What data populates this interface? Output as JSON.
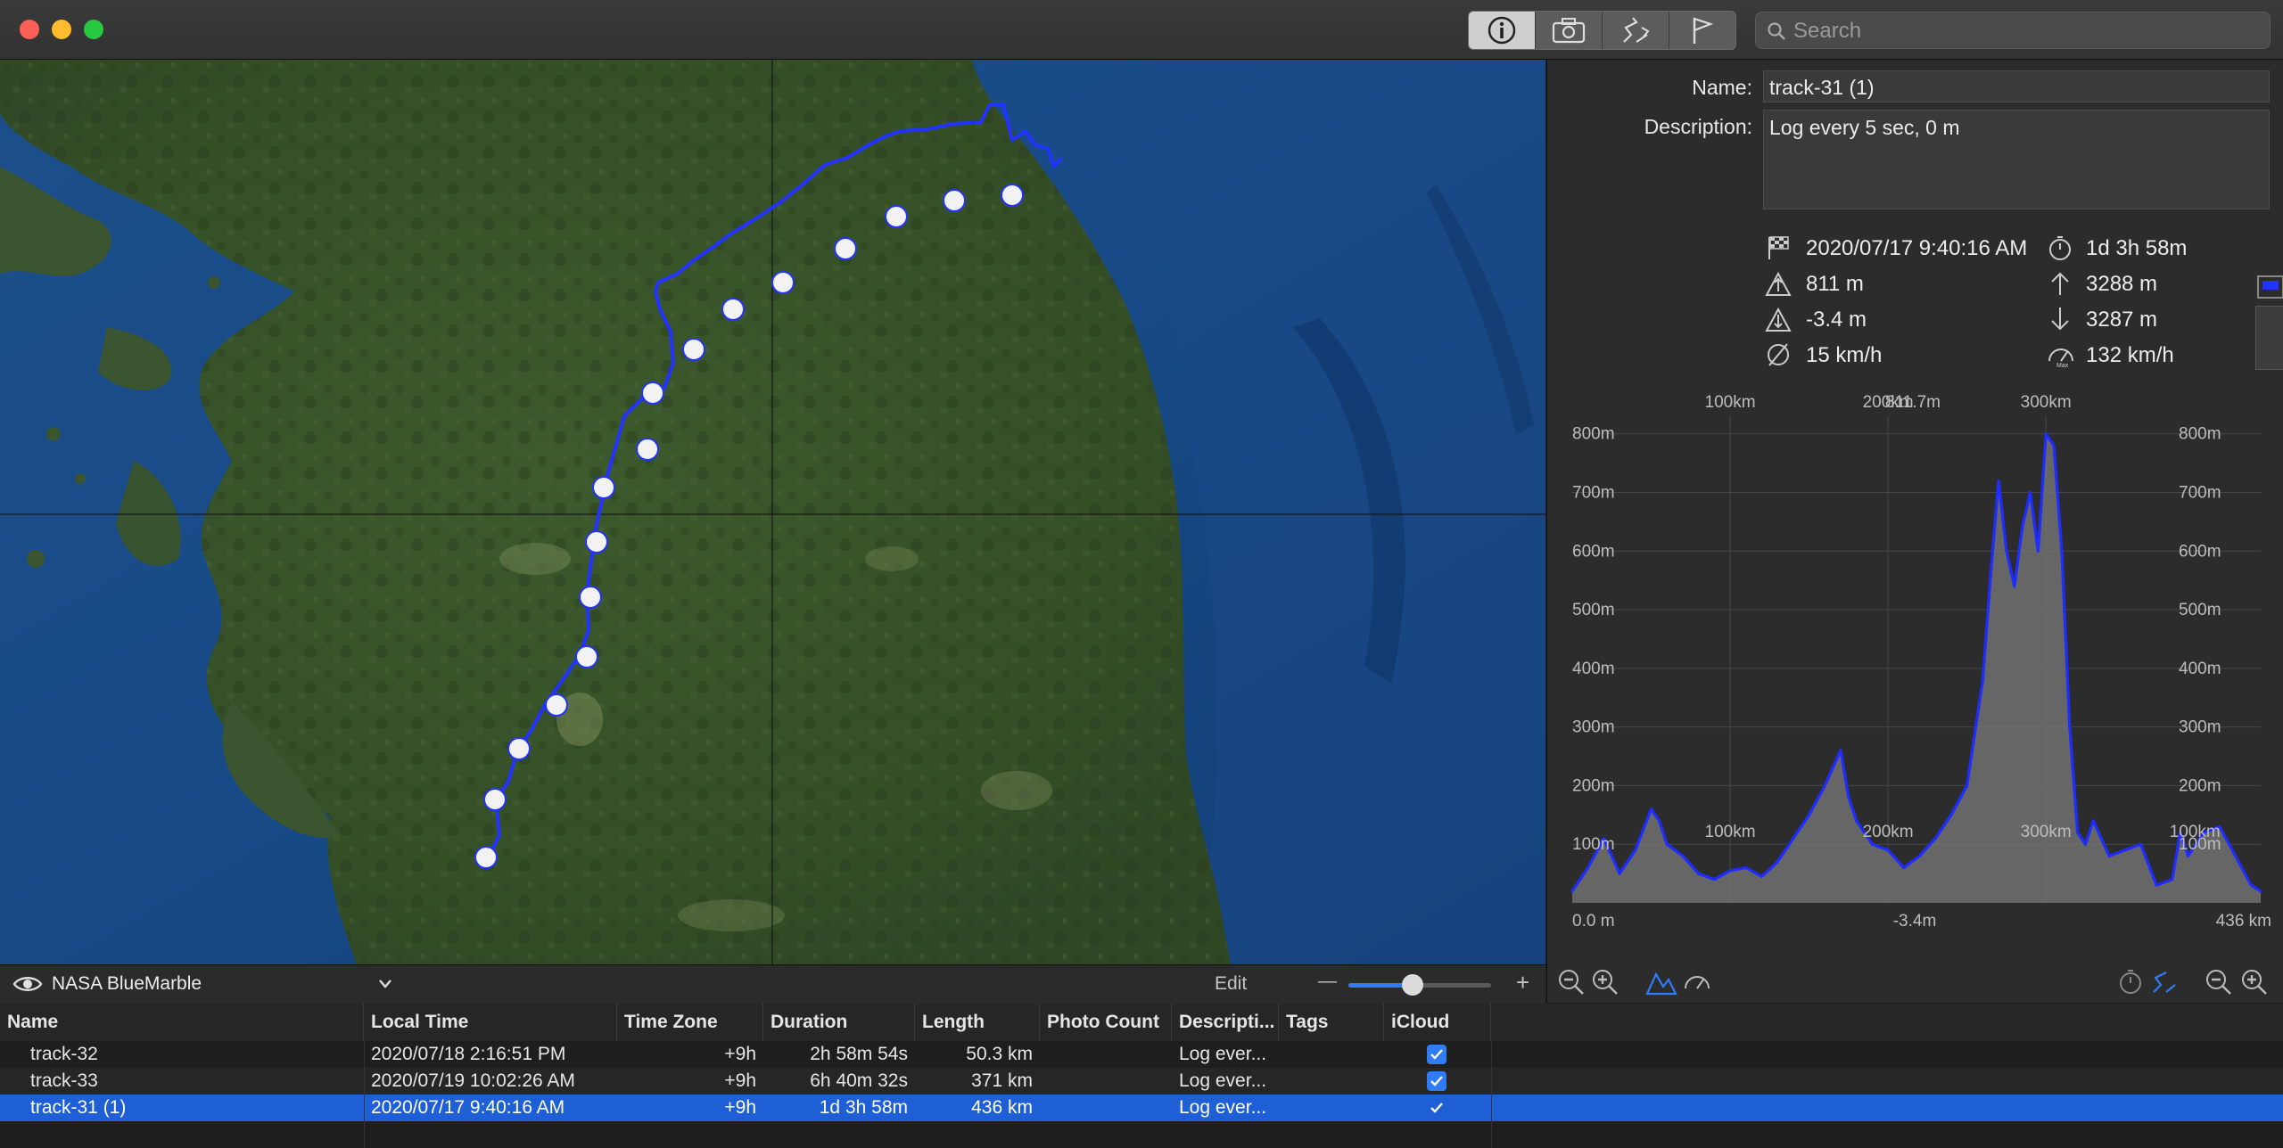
{
  "toolbar": {
    "tabs": [
      {
        "name": "info-icon",
        "active": true
      },
      {
        "name": "camera-icon",
        "active": false
      },
      {
        "name": "track-icon",
        "active": false
      },
      {
        "name": "flag-icon",
        "active": false
      }
    ],
    "search_placeholder": "Search"
  },
  "map": {
    "layer_name": "NASA BlueMarble",
    "edit_label": "Edit",
    "zoom_minus": "—",
    "zoom_plus": "+",
    "zoom_level": 0.45
  },
  "details": {
    "name_label": "Name:",
    "name_value": "track-31 (1)",
    "description_label": "Description:",
    "description_value": "Log every 5 sec, 0 m",
    "start_time": "2020/07/17 9:40:16 AM",
    "duration": "1d 3h 58m",
    "max_elevation": "811 m",
    "ascent": "3288 m",
    "min_elevation": "-3.4 m",
    "descent": "3287 m",
    "avg_speed": "15 km/h",
    "max_speed": "132 km/h"
  },
  "chart_data": {
    "type": "area",
    "peak_label": "811.7m",
    "min_label": "-3.4m",
    "y_ticks": [
      "100m",
      "200m",
      "300m",
      "400m",
      "500m",
      "600m",
      "700m",
      "800m"
    ],
    "top_x_ticks": [
      "100km",
      "200km",
      "300km"
    ],
    "inner_x_ticks": [
      "100km",
      "200km",
      "300km",
      "100km"
    ],
    "start_label": "0.0 m",
    "end_label": "436 km",
    "ylim": [
      0,
      830
    ],
    "xlim": [
      0,
      436
    ],
    "x": [
      0,
      10,
      20,
      30,
      40,
      50,
      55,
      60,
      70,
      80,
      90,
      100,
      110,
      120,
      130,
      140,
      150,
      160,
      170,
      175,
      180,
      190,
      200,
      210,
      220,
      230,
      240,
      250,
      260,
      265,
      270,
      275,
      280,
      285,
      290,
      295,
      300,
      305,
      310,
      315,
      320,
      325,
      330,
      340,
      350,
      360,
      370,
      380,
      385,
      390,
      400,
      410,
      420,
      430,
      436
    ],
    "values": [
      20,
      60,
      110,
      50,
      90,
      160,
      140,
      100,
      80,
      50,
      40,
      55,
      60,
      45,
      70,
      110,
      150,
      200,
      260,
      180,
      140,
      100,
      90,
      60,
      80,
      110,
      150,
      200,
      380,
      560,
      720,
      600,
      540,
      640,
      700,
      600,
      800,
      780,
      600,
      300,
      120,
      100,
      140,
      80,
      90,
      100,
      30,
      40,
      120,
      80,
      120,
      130,
      80,
      30,
      20
    ]
  },
  "chart_controls": {
    "left": [
      "zoom-out-icon",
      "zoom-in-icon",
      "elevation-icon",
      "speed-icon"
    ],
    "right": [
      "timer-icon",
      "distance-icon",
      "zoom-out-icon",
      "zoom-in-icon"
    ]
  },
  "table": {
    "columns": [
      "Name",
      "Local Time",
      "Time Zone",
      "Duration",
      "Length",
      "Photo Count",
      "Descripti...",
      "Tags",
      "iCloud"
    ],
    "rows": [
      {
        "name": "track-32",
        "local_time": "2020/07/18 2:16:51 PM",
        "tz": "+9h",
        "duration": "2h 58m 54s",
        "length": "50.3 km",
        "photos": "",
        "desc": "Log ever...",
        "tags": "",
        "icloud": true,
        "selected": false
      },
      {
        "name": "track-33",
        "local_time": "2020/07/19 10:02:26 AM",
        "tz": "+9h",
        "duration": "6h 40m 32s",
        "length": "371 km",
        "photos": "",
        "desc": "Log ever...",
        "tags": "",
        "icloud": true,
        "selected": false
      },
      {
        "name": "track-31 (1)",
        "local_time": "2020/07/17 9:40:16 AM",
        "tz": "+9h",
        "duration": "1d 3h 58m",
        "length": "436 km",
        "photos": "",
        "desc": "Log ever...",
        "tags": "",
        "icloud": true,
        "selected": true
      }
    ]
  },
  "colors": {
    "accent": "#2f7cf6",
    "track": "#1f2cff",
    "selected_row": "#1f5fd6"
  }
}
